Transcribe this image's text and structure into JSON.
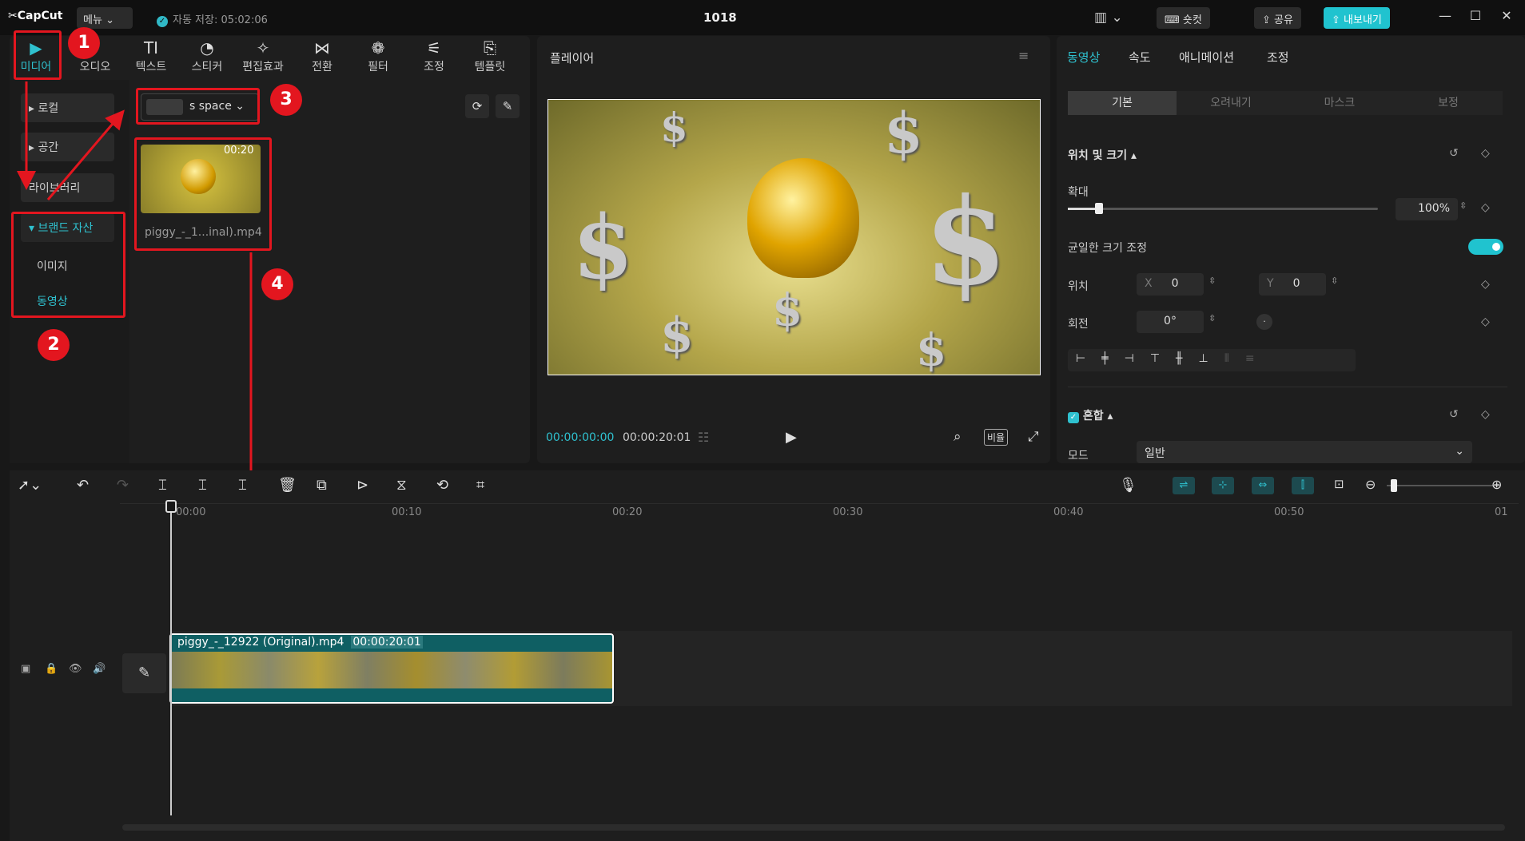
{
  "titlebar": {
    "logo": "CapCut",
    "menu_label": "메뉴",
    "autosave": "자동 저장: 05:02:06",
    "project_title": "1018",
    "shortcut_label": "숏컷",
    "share_label": "공유",
    "export_label": "내보내기"
  },
  "toolbar": {
    "items": [
      {
        "label": "미디어",
        "icon": "media-icon"
      },
      {
        "label": "오디오",
        "icon": "audio-icon"
      },
      {
        "label": "텍스트",
        "icon": "text-icon"
      },
      {
        "label": "스티커",
        "icon": "sticker-icon"
      },
      {
        "label": "편집효과",
        "icon": "effects-icon"
      },
      {
        "label": "전환",
        "icon": "transition-icon"
      },
      {
        "label": "필터",
        "icon": "filter-icon"
      },
      {
        "label": "조정",
        "icon": "adjust-icon"
      },
      {
        "label": "템플릿",
        "icon": "template-icon"
      }
    ]
  },
  "media_nav": {
    "local": "로컬",
    "space": "공간",
    "library": "라이브러리",
    "brand_assets": "브랜드 자산",
    "image": "이미지",
    "video": "동영상"
  },
  "media": {
    "space_label": "s space",
    "thumb_duration": "00:20",
    "thumb_name": "piggy_-_1...inal).mp4"
  },
  "annotations": [
    "1",
    "2",
    "3",
    "4"
  ],
  "player": {
    "title": "플레이어",
    "current_time": "00:00:00:00",
    "total_time": "00:00:20:01",
    "ratio_label": "비율"
  },
  "right_panel": {
    "tabs": [
      "동영상",
      "속도",
      "애니메이션",
      "조정"
    ],
    "segments": [
      "기본",
      "오려내기",
      "마스크",
      "보정"
    ],
    "position_size": "위치 및 크기",
    "scale_label": "확대",
    "scale_value": "100%",
    "scale_level": 0.1,
    "uniform_scale": "균일한 크기 조정",
    "uniform_scale_on": true,
    "position_label": "위치",
    "x_label": "X",
    "x_value": "0",
    "y_label": "Y",
    "y_value": "0",
    "rotation_label": "회전",
    "rotation_value": "0°",
    "blend_label": "혼합",
    "mode_label": "모드",
    "mode_value": "일반"
  },
  "timeline": {
    "ticks": [
      "00:00",
      "00:10",
      "00:20",
      "00:30",
      "00:40",
      "00:50",
      "01"
    ],
    "clip_name": "piggy_-_12922 (Original).mp4",
    "clip_duration": "00:00:20:01"
  },
  "colors": {
    "accent": "#2fc1cf",
    "annotation_red": "#e3161f",
    "clip_bg": "#0f5f63"
  }
}
